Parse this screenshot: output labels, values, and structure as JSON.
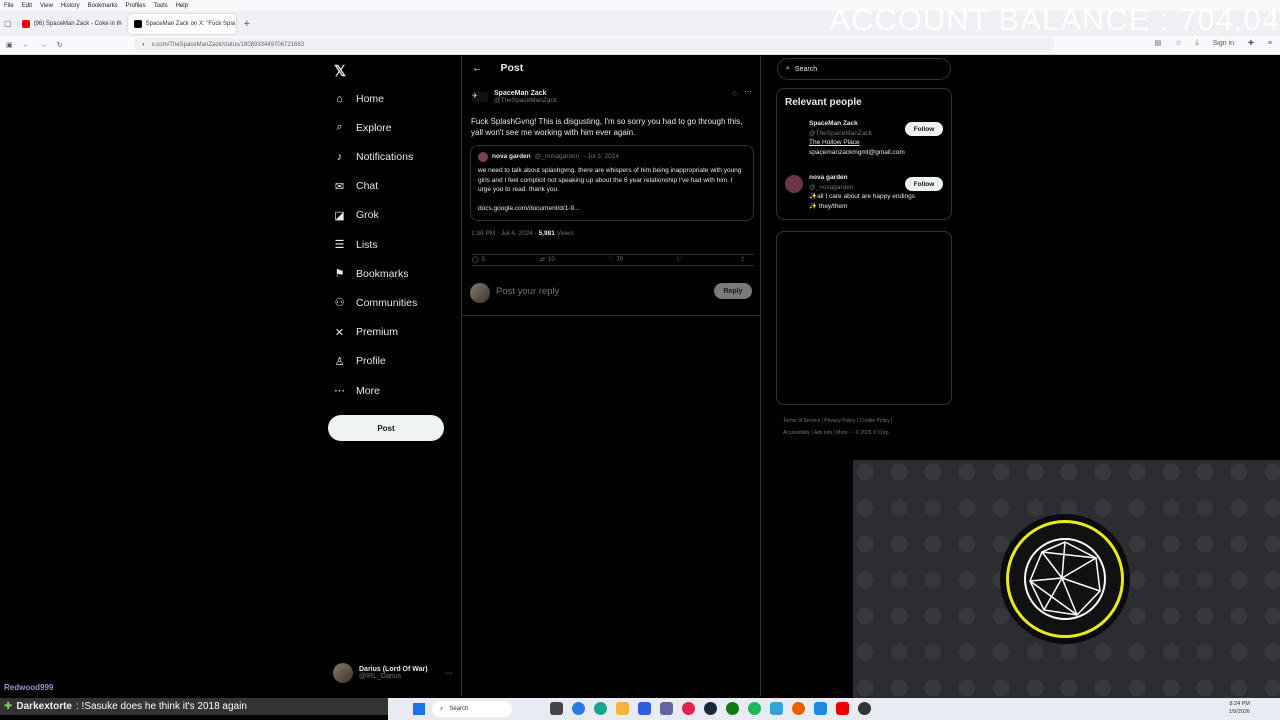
{
  "browser": {
    "menu": [
      "File",
      "Edit",
      "View",
      "History",
      "Bookmarks",
      "Profiles",
      "Tools",
      "Help"
    ],
    "tabs": [
      {
        "label": "(96) SpaceMan Zack - Coke in th"
      },
      {
        "label": "SpaceMan Zack on X: \"Fuck Spla"
      }
    ],
    "url": "x.com/TheSpaceManZack/status/1808933449706721683",
    "sign_in": "Sign in"
  },
  "overlay": {
    "balance": "ACCOUNT BALANCE : 704.04"
  },
  "nav": {
    "items": [
      {
        "label": "Home",
        "icon": "home-icon",
        "glyph": "⌂"
      },
      {
        "label": "Explore",
        "icon": "search-icon",
        "glyph": "⌕"
      },
      {
        "label": "Notifications",
        "icon": "bell-icon",
        "glyph": "♪"
      },
      {
        "label": "Chat",
        "icon": "mail-icon",
        "glyph": "✉"
      },
      {
        "label": "Grok",
        "icon": "grok-icon",
        "glyph": "◪"
      },
      {
        "label": "Lists",
        "icon": "list-icon",
        "glyph": "☰"
      },
      {
        "label": "Bookmarks",
        "icon": "bookmark-icon",
        "glyph": "⚑"
      },
      {
        "label": "Communities",
        "icon": "communities-icon",
        "glyph": "⚇"
      },
      {
        "label": "Premium",
        "icon": "x-icon",
        "glyph": "✕"
      },
      {
        "label": "Profile",
        "icon": "profile-icon",
        "glyph": "♙"
      },
      {
        "label": "More",
        "icon": "more-icon",
        "glyph": "⋯"
      }
    ],
    "post_button": "Post",
    "account": {
      "name": "Darius (Lord Of War)",
      "handle": "@IRL_Darius"
    }
  },
  "post": {
    "header": "Post",
    "author": {
      "name": "SpaceMan Zack",
      "handle": "@TheSpaceManZack"
    },
    "text": "Fuck SplashGvng! This is disgusting, I'm so sorry you had to go through this, yall won't see me working with him ever again.",
    "quote": {
      "author": "nova garden",
      "handle": "@_novagarden",
      "date": "· Jul 3, 2024",
      "text": "we need to talk about splashgvng. there are whispers of him being inappropriate with young girls and I feel complicit not speaking up about the 6 year relationship I've had with him. I urge you to read. thank you.",
      "link": "docs.google.com/document/d/1-9..."
    },
    "time": "1:38 PM · Jul 4, 2024 · ",
    "views_count": "5,981",
    "views_label": " Views",
    "stats": {
      "replies": "5",
      "reposts": "10",
      "likes": "70"
    },
    "reply_placeholder": "Post your reply",
    "reply_button": "Reply"
  },
  "sidebar": {
    "search_placeholder": "Search",
    "relevant_title": "Relevant people",
    "people": [
      {
        "name": "SpaceMan Zack",
        "handle": "@TheSpaceManZack",
        "bio1": "The Hollow Place",
        "bio2": "spacemanzackmgmt@gmail.com",
        "follow": "Follow"
      },
      {
        "name": "nova garden",
        "handle": "@_novagarden",
        "bio1": "✨all I care about are happy endings",
        "bio2": "✨ they/them",
        "follow": "Follow"
      }
    ],
    "footer1": "Terms of Service  |  Privacy Policy  |  Cookie Policy  |",
    "footer2": "Accessibility  |  Ads info  |  More ···  © 2026 X Corp."
  },
  "chat": {
    "viewer": "Redwood999",
    "name": "Darkextorte",
    "message": ": !Sasuke does he think it's 2018 again"
  },
  "taskbar": {
    "search": "Search",
    "time": "8:24 PM",
    "date": "1/9/2026"
  },
  "colors": {
    "accent": "#1d9bf0",
    "ring": "#e8ec16",
    "background": "#000000"
  }
}
